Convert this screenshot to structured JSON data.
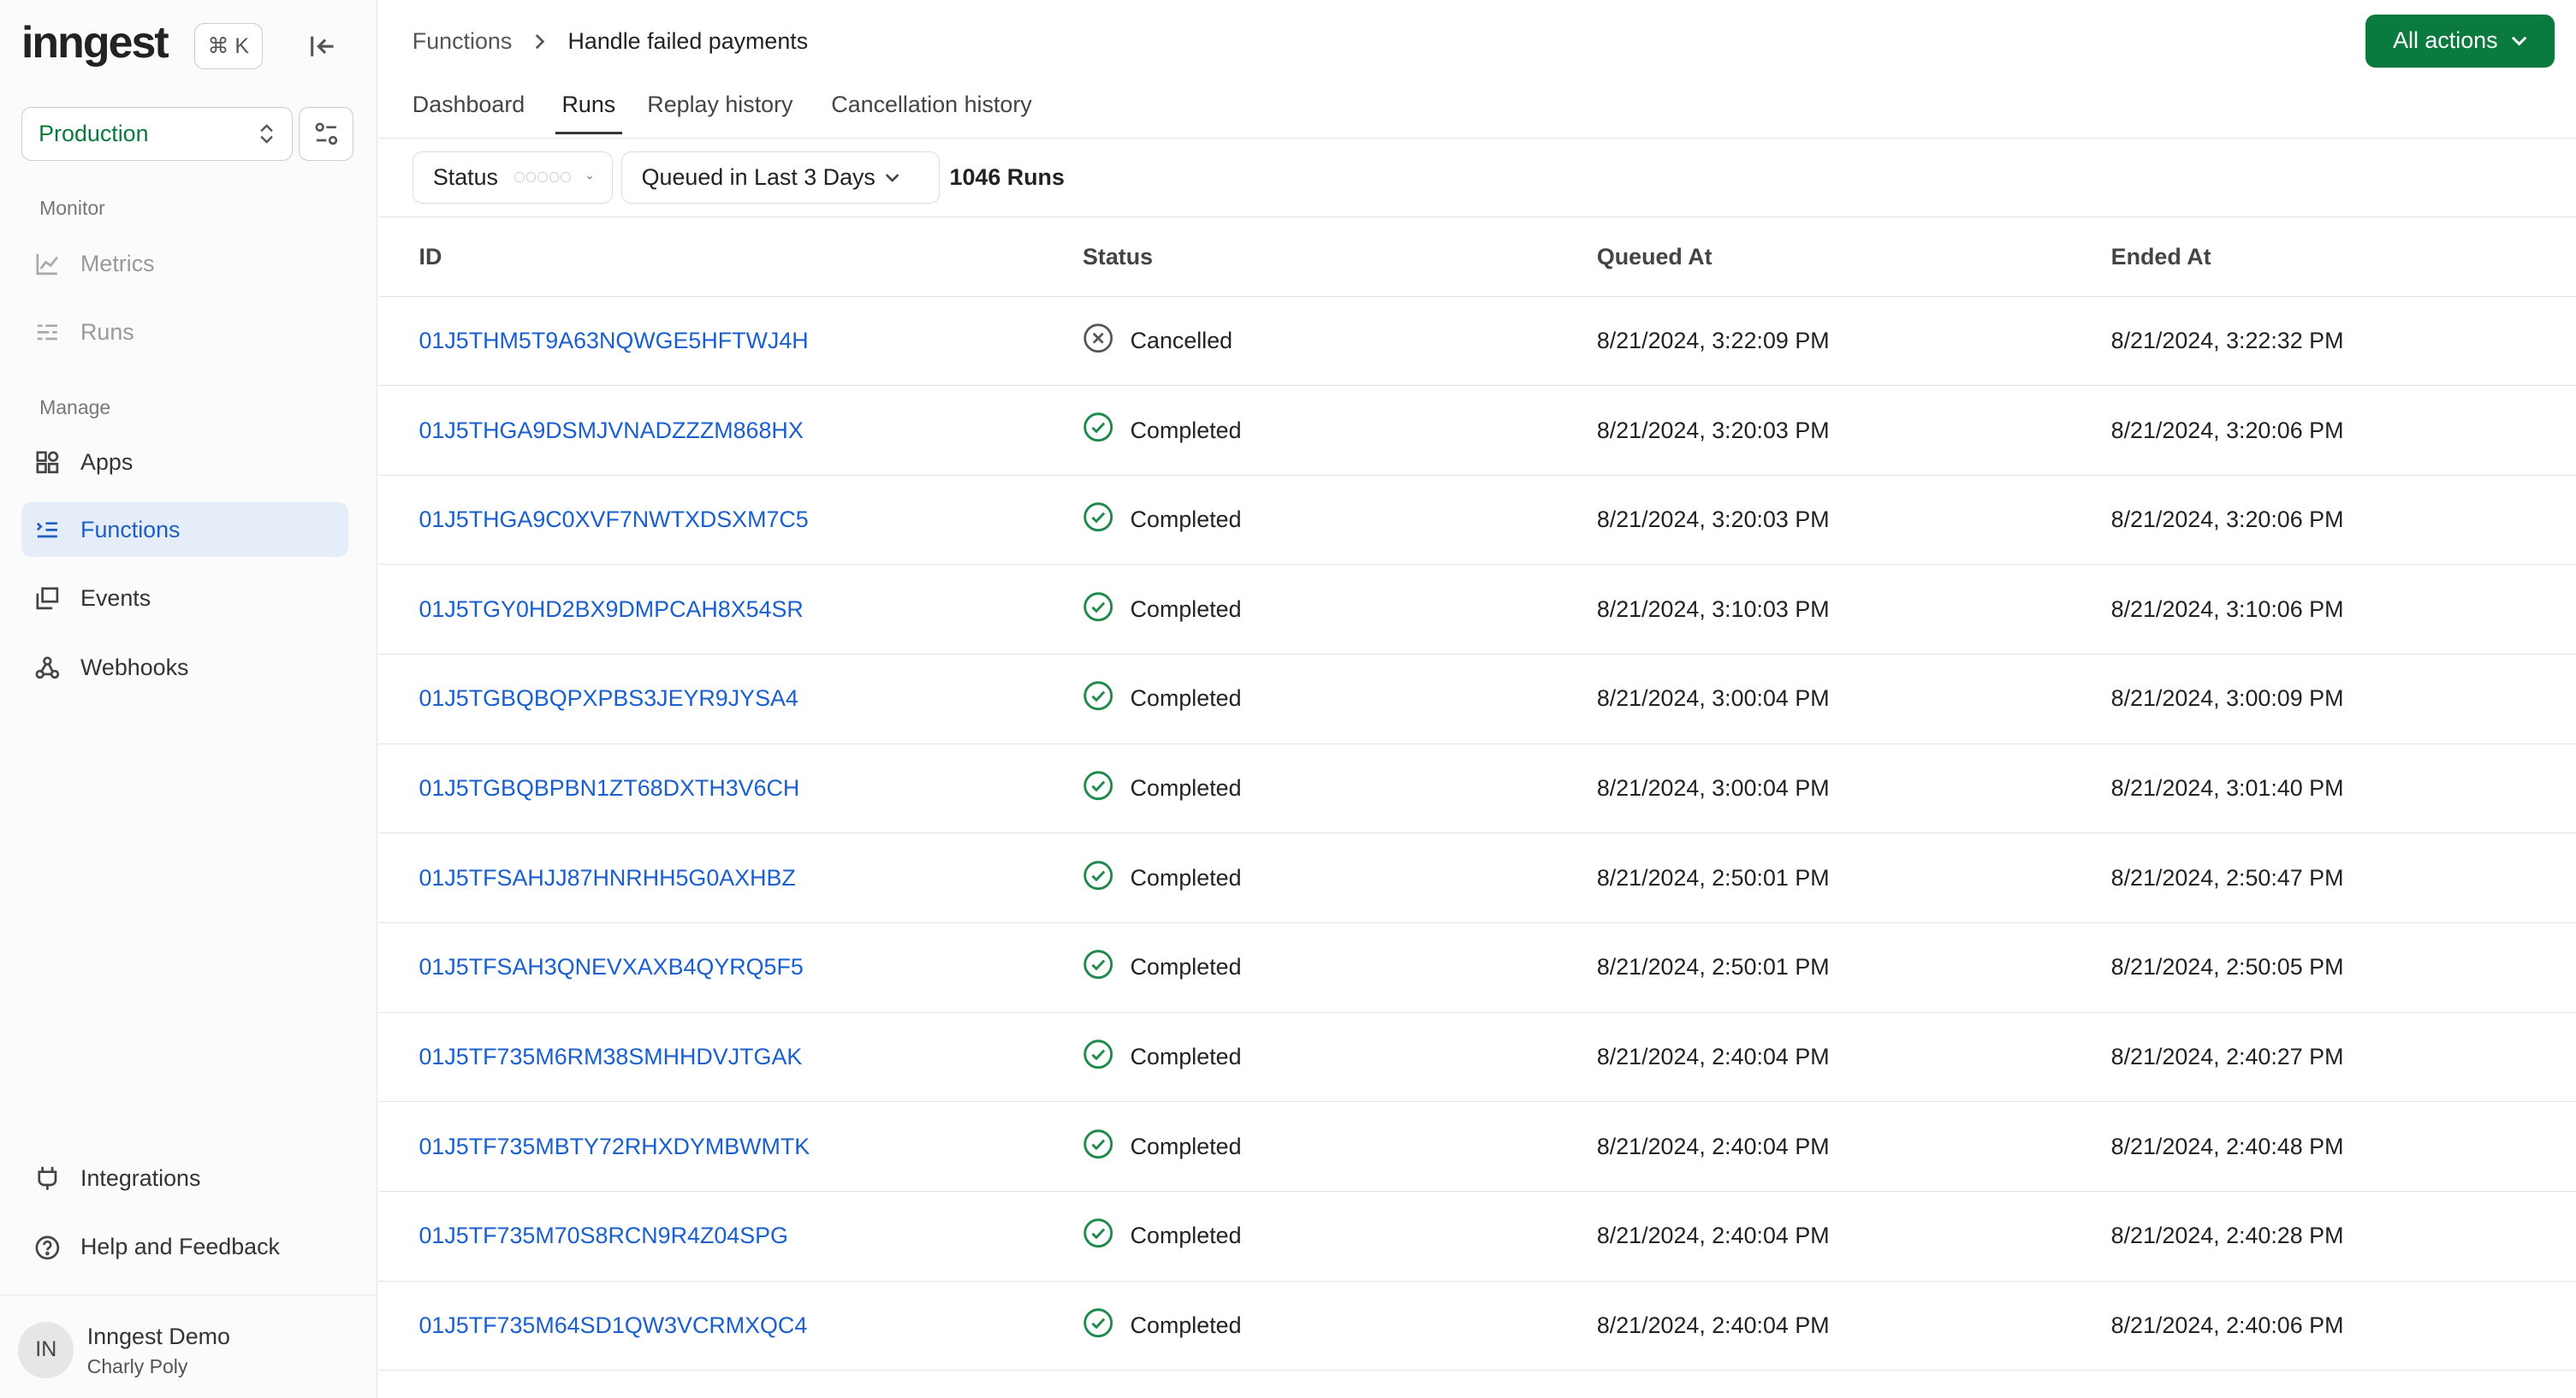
{
  "sidebar": {
    "logo": "inngest",
    "shortcut": "⌘ K",
    "environment": "Production",
    "sections": {
      "monitor": "Monitor",
      "manage": "Manage"
    },
    "monitor_items": [
      {
        "label": "Metrics"
      },
      {
        "label": "Runs"
      }
    ],
    "manage_items": [
      {
        "label": "Apps"
      },
      {
        "label": "Functions"
      },
      {
        "label": "Events"
      },
      {
        "label": "Webhooks"
      }
    ],
    "bottom_items": [
      {
        "label": "Integrations"
      },
      {
        "label": "Help and Feedback"
      }
    ],
    "user": {
      "initials": "IN",
      "org": "Inngest Demo",
      "name": "Charly Poly"
    }
  },
  "header": {
    "breadcrumb": [
      "Functions",
      "Handle failed payments"
    ],
    "all_actions": "All actions",
    "tabs": [
      "Dashboard",
      "Runs",
      "Replay history",
      "Cancellation history"
    ],
    "active_tab": "Runs"
  },
  "filters": {
    "status": "Status",
    "time": "Queued in Last 3 Days",
    "count": "1046 Runs"
  },
  "colors": {
    "accent": "#0b7a3e",
    "link": "#1a5fd0",
    "success": "#1f8a4c"
  },
  "table": {
    "columns": [
      "ID",
      "Status",
      "Queued At",
      "Ended At"
    ],
    "rows": [
      {
        "id": "01J5THM5T9A63NQWGE5HFTWJ4H",
        "status": "Cancelled",
        "queued": "8/21/2024, 3:22:09 PM",
        "ended": "8/21/2024, 3:22:32 PM"
      },
      {
        "id": "01J5THGA9DSMJVNADZZZM868HX",
        "status": "Completed",
        "queued": "8/21/2024, 3:20:03 PM",
        "ended": "8/21/2024, 3:20:06 PM"
      },
      {
        "id": "01J5THGA9C0XVF7NWTXDSXM7C5",
        "status": "Completed",
        "queued": "8/21/2024, 3:20:03 PM",
        "ended": "8/21/2024, 3:20:06 PM"
      },
      {
        "id": "01J5TGY0HD2BX9DMPCAH8X54SR",
        "status": "Completed",
        "queued": "8/21/2024, 3:10:03 PM",
        "ended": "8/21/2024, 3:10:06 PM"
      },
      {
        "id": "01J5TGBQBQPXPBS3JEYR9JYSA4",
        "status": "Completed",
        "queued": "8/21/2024, 3:00:04 PM",
        "ended": "8/21/2024, 3:00:09 PM"
      },
      {
        "id": "01J5TGBQBPBN1ZT68DXTH3V6CH",
        "status": "Completed",
        "queued": "8/21/2024, 3:00:04 PM",
        "ended": "8/21/2024, 3:01:40 PM"
      },
      {
        "id": "01J5TFSAHJJ87HNRHH5G0AXHBZ",
        "status": "Completed",
        "queued": "8/21/2024, 2:50:01 PM",
        "ended": "8/21/2024, 2:50:47 PM"
      },
      {
        "id": "01J5TFSAH3QNEVXAXB4QYRQ5F5",
        "status": "Completed",
        "queued": "8/21/2024, 2:50:01 PM",
        "ended": "8/21/2024, 2:50:05 PM"
      },
      {
        "id": "01J5TF735M6RM38SMHHDVJTGAK",
        "status": "Completed",
        "queued": "8/21/2024, 2:40:04 PM",
        "ended": "8/21/2024, 2:40:27 PM"
      },
      {
        "id": "01J5TF735MBTY72RHXDYMBWMTK",
        "status": "Completed",
        "queued": "8/21/2024, 2:40:04 PM",
        "ended": "8/21/2024, 2:40:48 PM"
      },
      {
        "id": "01J5TF735M70S8RCN9R4Z04SPG",
        "status": "Completed",
        "queued": "8/21/2024, 2:40:04 PM",
        "ended": "8/21/2024, 2:40:28 PM"
      },
      {
        "id": "01J5TF735M64SD1QW3VCRMXQC4",
        "status": "Completed",
        "queued": "8/21/2024, 2:40:04 PM",
        "ended": "8/21/2024, 2:40:06 PM"
      }
    ]
  }
}
